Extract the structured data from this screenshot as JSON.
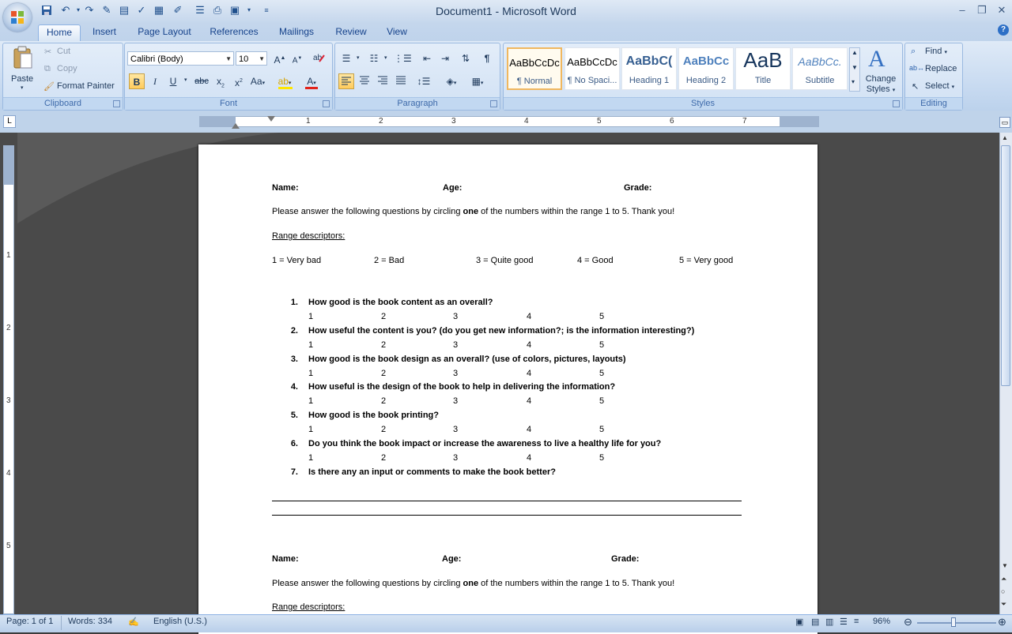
{
  "window": {
    "title_doc": "Document1",
    "title_sep": " - ",
    "title_app": "Microsoft Word"
  },
  "tabs": [
    "Home",
    "Insert",
    "Page Layout",
    "References",
    "Mailings",
    "Review",
    "View"
  ],
  "clipboard": {
    "paste": "Paste",
    "cut": "Cut",
    "copy": "Copy",
    "format_painter": "Format Painter",
    "label": "Clipboard"
  },
  "font": {
    "name": "Calibri (Body)",
    "size": "10",
    "label": "Font"
  },
  "paragraph": {
    "label": "Paragraph"
  },
  "styles": {
    "label": "Styles",
    "items": [
      {
        "preview": "AaBbCcDc",
        "name": "¶ Normal"
      },
      {
        "preview": "AaBbCcDc",
        "name": "¶ No Spaci..."
      },
      {
        "preview": "AaBbC(",
        "name": "Heading 1"
      },
      {
        "preview": "AaBbCc",
        "name": "Heading 2"
      },
      {
        "preview": "AaB",
        "name": "Title"
      },
      {
        "preview": "AaBbCc.",
        "name": "Subtitle"
      }
    ],
    "change_styles_1": "Change",
    "change_styles_2": "Styles"
  },
  "editing": {
    "find": "Find",
    "replace": "Replace",
    "select": "Select",
    "label": "Editing"
  },
  "ruler": {
    "numbers": [
      "1",
      "2",
      "3",
      "4",
      "5",
      "6",
      "7"
    ]
  },
  "document": {
    "header": {
      "name": "Name:",
      "age": "Age:",
      "grade": "Grade:"
    },
    "instruction_pre": "Please answer the following questions by circling ",
    "instruction_bold": "one",
    "instruction_post": " of the numbers within the range 1 to 5. Thank you!",
    "range_title": "Range descriptors:",
    "ranges": [
      "1 = Very bad",
      "2 = Bad",
      "3 = Quite good",
      "4 = Good",
      "5 = Very good"
    ],
    "scale": [
      "1",
      "2",
      "3",
      "4",
      "5"
    ],
    "questions": [
      {
        "num": "1.",
        "text": "How good is the book content as an overall?"
      },
      {
        "num": "2.",
        "text": "How useful the content is you? (do you get new information?; is the information interesting?)"
      },
      {
        "num": "3.",
        "text": "How good is the book design as an overall? (use of colors, pictures, layouts)"
      },
      {
        "num": "4.",
        "text": "How useful is the design of the book to help in delivering the information?"
      },
      {
        "num": "5.",
        "text": "How good is the book printing?"
      },
      {
        "num": "6.",
        "text": "Do you think the book impact or increase the awareness to live a healthy life for you?"
      },
      {
        "num": "7.",
        "text": "Is there any an input or comments to make the book better?"
      }
    ]
  },
  "status": {
    "page": "Page: 1 of 1",
    "words": "Words: 334",
    "language": "English (U.S.)",
    "zoom": "96%"
  },
  "colors": {
    "accent": "#15428b",
    "ribbon": "#c6d9f0",
    "doc_bg": "#4a4a4a"
  }
}
